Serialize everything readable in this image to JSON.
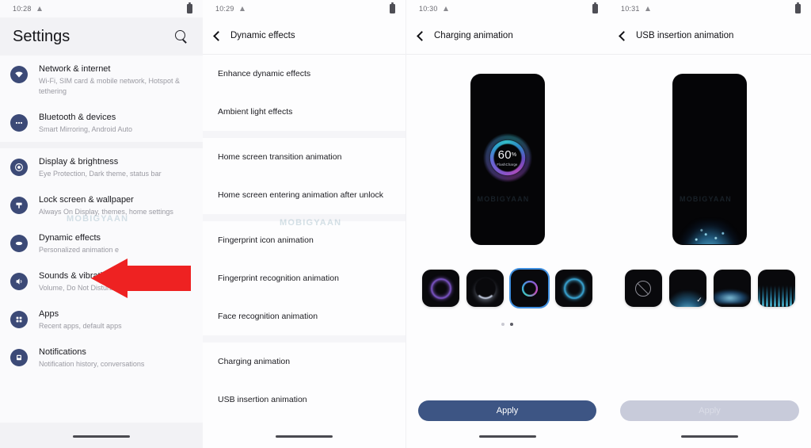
{
  "panels": [
    {
      "status": {
        "time": "10:28",
        "signal_icon": "triangle-signal-icon",
        "battery_icon": "battery-icon"
      },
      "header": {
        "title": "Settings",
        "search_icon": "search-icon"
      },
      "items": [
        {
          "icon": "wifi-icon",
          "title": "Network & internet",
          "subtitle": "Wi-Fi, SIM card & mobile network, Hotspot & tethering"
        },
        {
          "icon": "bluetooth-devices-icon",
          "title": "Bluetooth & devices",
          "subtitle": "Smart Mirroring, Android Auto"
        },
        {
          "icon": "display-brightness-icon",
          "title": "Display & brightness",
          "subtitle": "Eye Protection, Dark theme, status bar"
        },
        {
          "icon": "lock-screen-wallpaper-icon",
          "title": "Lock screen & wallpaper",
          "subtitle": "Always On Display, themes, home settings"
        },
        {
          "icon": "dynamic-effects-icon",
          "title": "Dynamic effects",
          "subtitle": "Personalized animation e"
        },
        {
          "icon": "sounds-vibration-icon",
          "title": "Sounds & vibration",
          "subtitle": "Volume, Do Not Disturb mode"
        },
        {
          "icon": "apps-icon",
          "title": "Apps",
          "subtitle": "Recent apps, default apps"
        },
        {
          "icon": "notifications-icon",
          "title": "Notifications",
          "subtitle": "Notification history, conversations"
        }
      ]
    },
    {
      "status": {
        "time": "10:29",
        "signal_icon": "triangle-signal-icon",
        "battery_icon": "battery-icon"
      },
      "header": {
        "back_icon": "back-chevron-icon",
        "title": "Dynamic effects"
      },
      "group_a": [
        "Enhance dynamic effects",
        "Ambient light effects"
      ],
      "group_b": [
        "Home screen transition animation",
        "Home screen entering animation after unlock"
      ],
      "group_c": [
        "Fingerprint icon animation",
        "Fingerprint recognition animation",
        "Face recognition animation"
      ],
      "group_d": [
        "Charging animation",
        "USB insertion animation"
      ]
    },
    {
      "status": {
        "time": "10:30",
        "signal_icon": "triangle-signal-icon",
        "battery_icon": "battery-icon"
      },
      "header": {
        "back_icon": "back-chevron-icon",
        "title": "Charging animation"
      },
      "preview": {
        "percent": "60",
        "percent_unit": "%",
        "label": "FlashCharge"
      },
      "thumbnails": [
        {
          "name": "purple-ring-style",
          "selected": false
        },
        {
          "name": "white-arc-style",
          "selected": false
        },
        {
          "name": "multicolor-ring-style",
          "selected": true
        },
        {
          "name": "cyan-ring-style",
          "selected": false
        }
      ],
      "pager": {
        "count": 2,
        "active": 2
      },
      "apply": {
        "label": "Apply",
        "enabled": true
      }
    },
    {
      "status": {
        "time": "10:31",
        "signal_icon": "triangle-signal-icon",
        "battery_icon": "battery-icon"
      },
      "header": {
        "back_icon": "back-chevron-icon",
        "title": "USB insertion animation"
      },
      "preview": {
        "style": "cyan-bottom-glow"
      },
      "thumbnails": [
        {
          "name": "none-style",
          "selected": false
        },
        {
          "name": "cyan-particles-style",
          "selected": true
        },
        {
          "name": "cyan-wave-style",
          "selected": false
        },
        {
          "name": "cyan-flame-style",
          "selected": false
        }
      ],
      "apply": {
        "label": "Apply",
        "enabled": false
      }
    }
  ],
  "annotations": {
    "arrow_color": "#ee2222",
    "box_color": "#ee2222",
    "watermark_text": "MOBIGYAAN"
  },
  "theme": {
    "accent_blue": "#3d5584",
    "icon_navy": "#3c4a77",
    "selection_blue": "#3f8fe0",
    "disabled_grey": "#c8cbda"
  }
}
